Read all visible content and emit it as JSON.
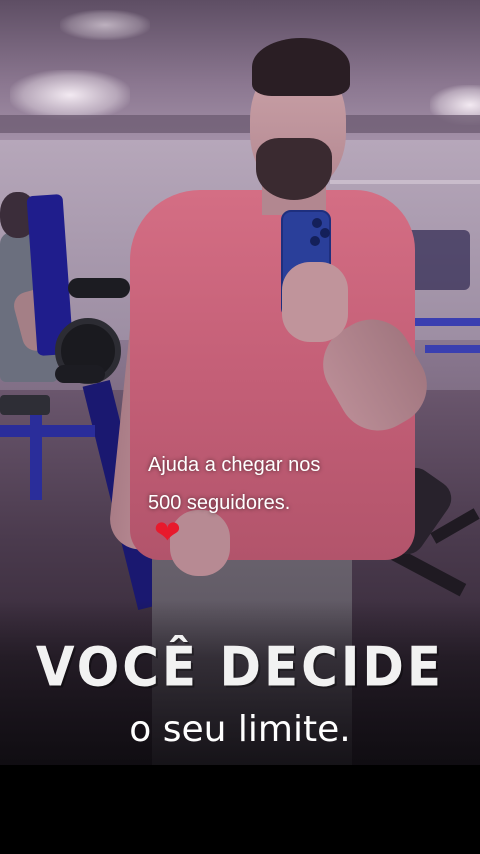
{
  "story": {
    "caption_line1": "Ajuda a chegar nos",
    "caption_line2": "500 seguidores.",
    "heart_icon": "red-heart",
    "headline": "VOCÊ DECIDE",
    "subline": "o seu limite."
  },
  "colors": {
    "heart": "#e8192c",
    "shirt": "#c45f77",
    "phone": "#2a3f9a",
    "machine": "#27258f"
  }
}
